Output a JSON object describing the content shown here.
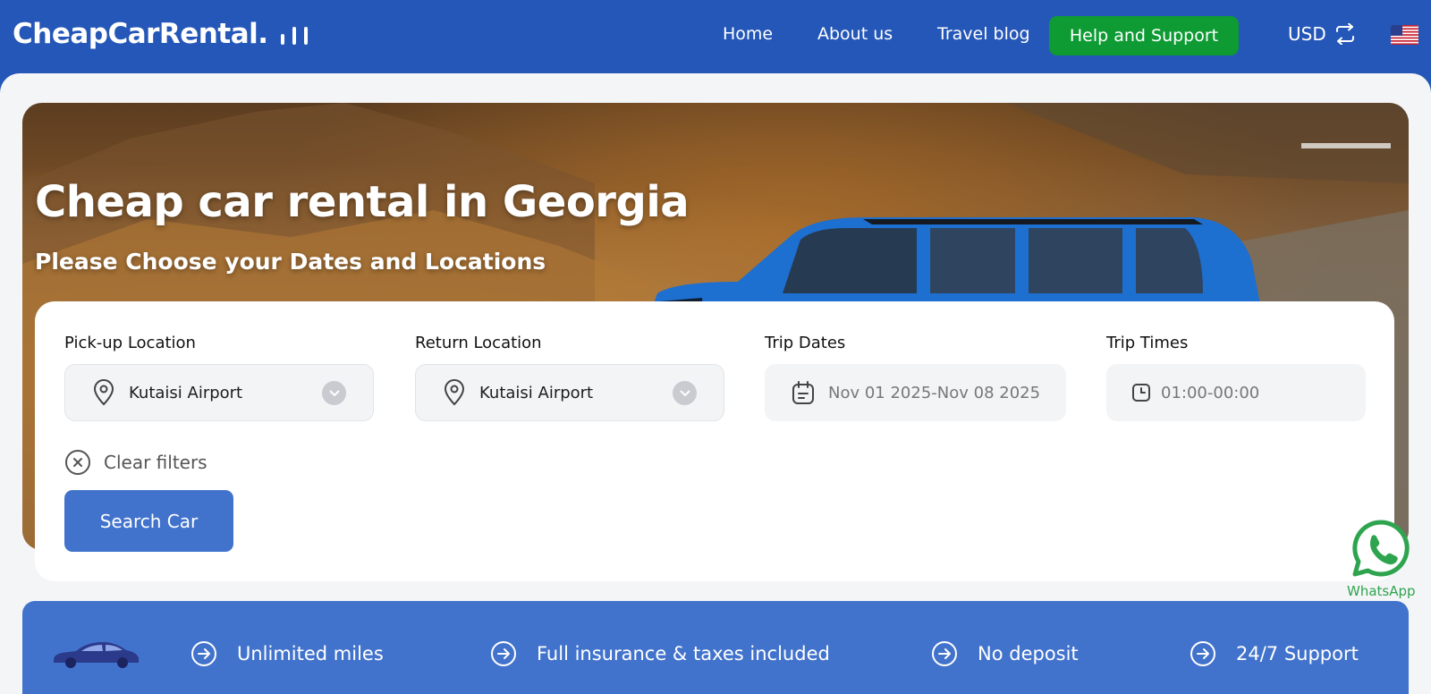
{
  "header": {
    "logo": "CheapCarRental.",
    "nav": {
      "home": "Home",
      "about": "About us",
      "blog": "Travel blog"
    },
    "help_button": "Help and Support",
    "currency": "USD"
  },
  "hero": {
    "title": "Cheap car rental in Georgia",
    "subtitle": "Please Choose your Dates and Locations"
  },
  "search": {
    "pickup": {
      "label": "Pick-up Location",
      "value": "Kutaisi Airport"
    },
    "return": {
      "label": "Return Location",
      "value": "Kutaisi Airport"
    },
    "dates": {
      "label": "Trip Dates",
      "value": "Nov 01 2025-Nov 08 2025"
    },
    "times": {
      "label": "Trip Times",
      "value": "01:00-00:00"
    },
    "clear_filters": "Clear filters",
    "search_button": "Search Car"
  },
  "whatsapp": {
    "label": "WhatsApp"
  },
  "features": [
    "Unlimited miles",
    "Full insurance & taxes included",
    "No deposit",
    "24/7 Support"
  ],
  "colors": {
    "header_blue": "#2557b8",
    "accent_blue": "#4273cc",
    "help_green": "#0e9b34",
    "whatsapp_green": "#2ea44f"
  },
  "icons": [
    "location-pin-icon",
    "chevron-down-icon",
    "calendar-icon",
    "clock-icon",
    "close-circle-icon",
    "arrow-right-circle-icon",
    "swap-icon",
    "us-flag-icon",
    "whatsapp-icon",
    "car-icon"
  ]
}
